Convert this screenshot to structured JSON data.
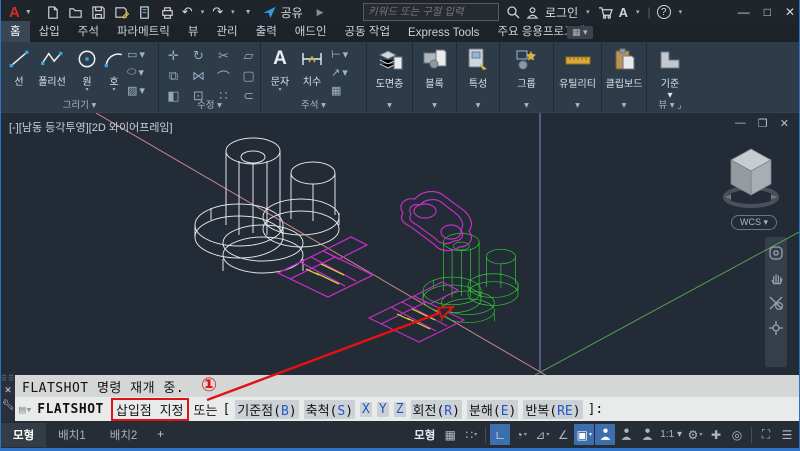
{
  "palette": {
    "canvas_bg": "#232b36",
    "ribbon_bg": "#2e3b49",
    "titlebar_bg": "#20252c",
    "object_white": "#e6e6e6",
    "object_magenta": "#c32fc3",
    "object_green": "#2ed22e",
    "hidden_yellow": "#d8d833",
    "xline_salmon": "#c98989",
    "axis_green": "#55a055",
    "axis_z": "#8585d8",
    "annotation_red": "#e01212",
    "keyword_blue": "#2457c5",
    "status_active_blue": "#3d6fae",
    "window_edge_blue": "#2b72c8"
  },
  "titlebar": {
    "logo": "A",
    "share": "공유",
    "search_placeholder": "키워드 또는 구절 입력",
    "login": "로그인"
  },
  "ribbon": {
    "tabs": [
      {
        "label": "홈",
        "active": true
      },
      {
        "label": "삽입",
        "active": false
      },
      {
        "label": "주석",
        "active": false
      },
      {
        "label": "파라메트릭",
        "active": false
      },
      {
        "label": "뷰",
        "active": false
      },
      {
        "label": "관리",
        "active": false
      },
      {
        "label": "출력",
        "active": false
      },
      {
        "label": "애드인",
        "active": false
      },
      {
        "label": "공동 작업",
        "active": false
      },
      {
        "label": "Express Tools",
        "active": false
      },
      {
        "label": "주요 응용프로그램",
        "active": false
      }
    ],
    "draw": {
      "label": "그리기 ▾",
      "line": "선",
      "polyline": "폴리선",
      "circle": "원",
      "arc": "호"
    },
    "modify": {
      "label": "수정 ▾"
    },
    "annotation": {
      "label": "주석 ▾",
      "text": "문자",
      "dimension": "치수"
    },
    "layers": {
      "label": "▾",
      "button": "도면층"
    },
    "block": {
      "label": "▾",
      "button": "블록"
    },
    "properties": {
      "label": "▾",
      "button": "특성"
    },
    "groups": {
      "label": "▾",
      "button": "그룹"
    },
    "utilities": {
      "label": "▾",
      "button": "유틸리티"
    },
    "clipboard": {
      "label": "▾",
      "button": "클립보드"
    },
    "view": {
      "label": "뷰 ▾ ⌟",
      "button": "기준"
    }
  },
  "viewport": {
    "controls": "[-][남동 등각투영][2D 와이어프레임]",
    "wcs": "WCS ▾"
  },
  "command": {
    "history": "FLATSHOT 명령 재개 중.",
    "name": "FLATSHOT",
    "action": "삽입점 지정",
    "or": "또는",
    "bracket_open": "[",
    "keywords": [
      {
        "pre": "기준점(",
        "key": "B",
        "post": ")"
      },
      {
        "pre": "축척(",
        "key": "S",
        "post": ")"
      },
      {
        "pre": "",
        "key": "X",
        "post": ""
      },
      {
        "pre": "",
        "key": "Y",
        "post": ""
      },
      {
        "pre": "",
        "key": "Z",
        "post": ""
      },
      {
        "pre": "회전(",
        "key": "R",
        "post": ")"
      },
      {
        "pre": "분해(",
        "key": "E",
        "post": ")"
      },
      {
        "pre": "반복(",
        "key": "RE",
        "post": ")"
      }
    ],
    "bracket_close": "]:"
  },
  "annotation_marker": {
    "number": "①"
  },
  "layout_tabs": [
    {
      "label": "모형",
      "active": true
    },
    {
      "label": "배치1",
      "active": false
    },
    {
      "label": "배치2",
      "active": false
    }
  ],
  "layout_plus": "+",
  "statusbar": {
    "model": "모형",
    "scale": "1:1 ▾"
  }
}
